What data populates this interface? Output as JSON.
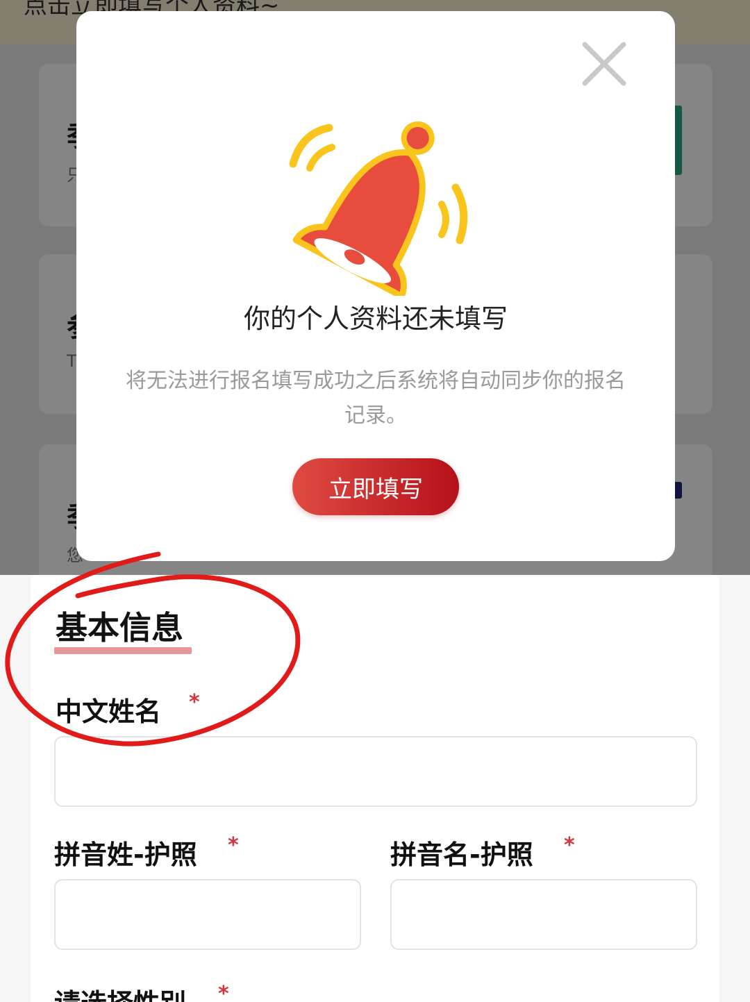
{
  "background": {
    "notice": "点击立即填写个人资料~",
    "cards": [
      {
        "title": "季",
        "subtitle": "只"
      },
      {
        "title": "参",
        "subtitle": "T"
      },
      {
        "title": "季",
        "subtitle": "您"
      }
    ]
  },
  "modal": {
    "icon": "bell-icon",
    "close_icon": "close-icon",
    "title": "你的个人资料还未填写",
    "description": "将无法进行报名填写成功之后系统将自动同步你的报名记录。",
    "button_label": "立即填写",
    "colors": {
      "button_start": "#e04a42",
      "button_end": "#b51119",
      "bell": "#e74c3c",
      "bell_outline": "#f9c41c"
    }
  },
  "form": {
    "section_title": "基本信息",
    "required_mark": "*",
    "fields": {
      "chinese_name": {
        "label": "中文姓名",
        "value": ""
      },
      "pinyin_surname": {
        "label": "拼音姓-护照",
        "value": ""
      },
      "pinyin_given": {
        "label": "拼音名-护照",
        "value": ""
      },
      "gender": {
        "label": "请选择性别"
      }
    }
  }
}
